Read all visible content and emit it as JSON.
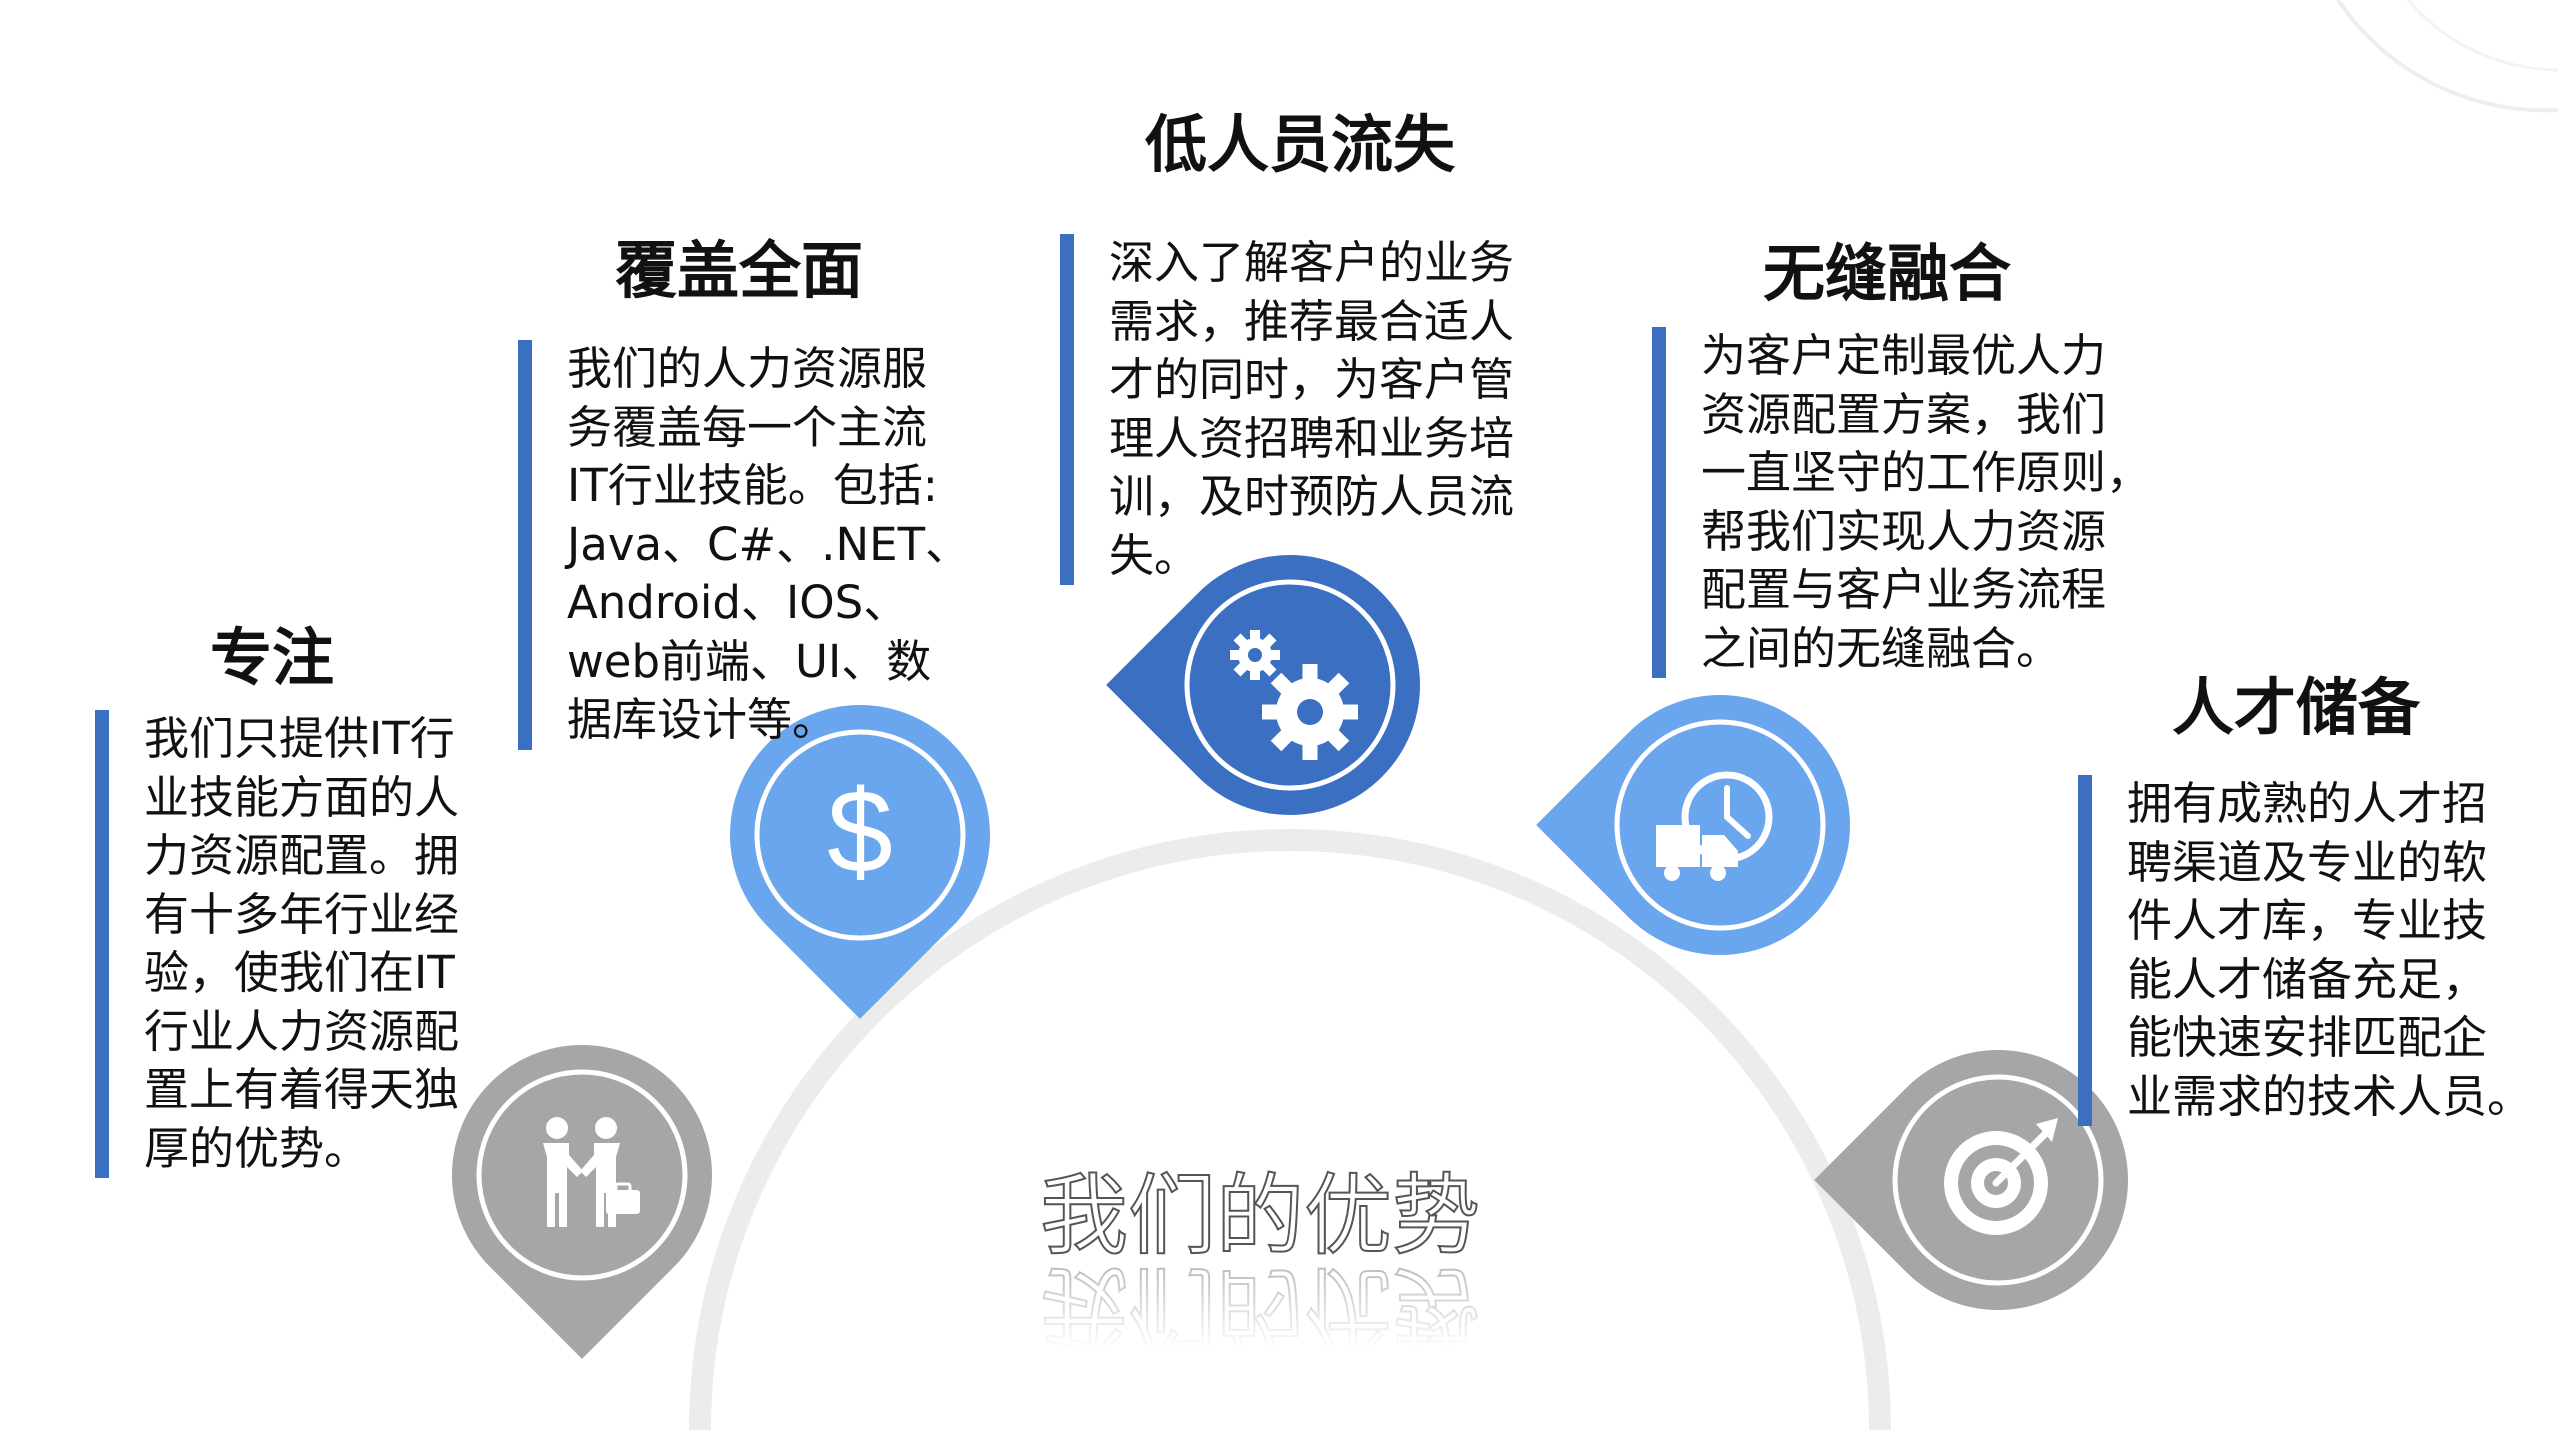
{
  "subtitle": "我们的优势",
  "colors": {
    "blue_dark": "#3a6fc2",
    "blue_light": "#6aa6ee",
    "gray": "#a6a6a6",
    "arc": "#ececec"
  },
  "items": [
    {
      "title": "专注",
      "lines": [
        "我们只提供IT行",
        "业技能方面的人",
        "力资源配置。拥",
        "有十多年行业经",
        "验，使我们在IT",
        "行业人力资源配",
        "置上有着得天独",
        "厚的优势。"
      ],
      "icon": "handshake-icon"
    },
    {
      "title": "覆盖全面",
      "lines": [
        "我们的人力资源服",
        "务覆盖每一个主流",
        "IT行业技能。包括:",
        "Java、C#、.NET、",
        "Android、IOS、",
        "web前端、UI、数",
        "据库设计等。"
      ],
      "icon": "dollar-icon"
    },
    {
      "title": "低人员流失",
      "lines": [
        "深入了解客户的业务",
        "需求，推荐最合适人",
        "才的同时，为客户管",
        "理人资招聘和业务培",
        "训，及时预防人员流",
        "失。"
      ],
      "icon": "gears-icon"
    },
    {
      "title": "无缝融合",
      "lines": [
        "为客户定制最优人力",
        "资源配置方案，我们",
        "一直坚守的工作原则，",
        "帮我们实现人力资源",
        "配置与客户业务流程",
        "之间的无缝融合。"
      ],
      "icon": "delivery-clock-icon"
    },
    {
      "title": "人才储备",
      "lines": [
        "拥有成熟的人才招",
        "聘渠道及专业的软",
        "件人才库，专业技",
        "能人才储备充足，",
        "能快速安排匹配企",
        "业需求的技术人员。"
      ],
      "icon": "target-icon"
    }
  ]
}
